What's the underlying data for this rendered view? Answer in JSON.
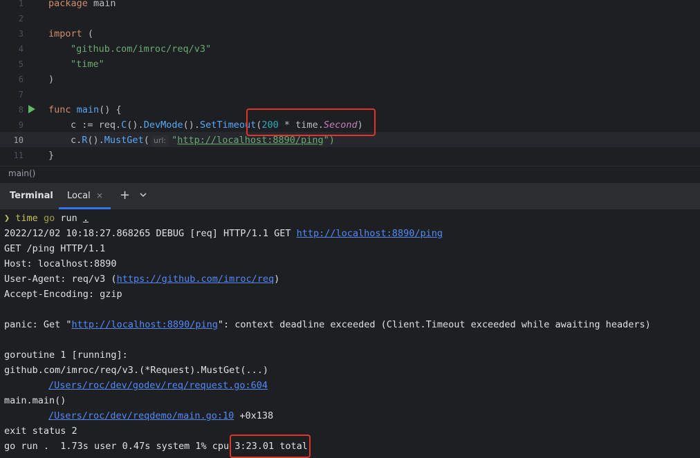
{
  "editor": {
    "line_numbers": [
      "1",
      "2",
      "3",
      "4",
      "5",
      "6",
      "7",
      "8",
      "9",
      "10",
      "11"
    ],
    "lines": {
      "l1_kw": "package",
      "l1_rest": " main",
      "l3_kw": "import",
      "l3_rest": " (",
      "l4": "\"github.com/imroc/req/v3\"",
      "l5": "\"time\"",
      "l6": ")",
      "l8_kw": "func",
      "l8_fn": "main",
      "l8_rest": "() {",
      "l9_a": "c := ",
      "l9_pkg": "req.",
      "l9_c": "C",
      "l9_p1": "().",
      "l9_dev": "DevMode",
      "l9_p2": "().",
      "l9_set": "SetTimeout",
      "l9_p3": "(",
      "l9_num": "200",
      "l9_op": " * time.",
      "l9_type": "Second",
      "l9_end": ")",
      "l10_a": "c.",
      "l10_r": "R",
      "l10_b": "().",
      "l10_must": "MustGet",
      "l10_c": "(",
      "l10_hint": "url:",
      "l10_q1": "\"",
      "l10_url": "http://localhost:8890/ping",
      "l10_q2": "\")",
      "l11": "}"
    }
  },
  "breadcrumb": "main()",
  "terminal": {
    "title": "Terminal",
    "tab_label": "Local",
    "tab_close": "×",
    "add": "+",
    "prompt_symbol": "❯",
    "prompt_time": "time",
    "prompt_go": "go",
    "prompt_rest": "run",
    "prompt_dot": ".",
    "out1_a": "2022/12/02 10:18:27.868265 DEBUG [req] HTTP/1.1 GET ",
    "out1_link": "http://localhost:8890/ping",
    "out2": "GET /ping HTTP/1.1",
    "out3": "Host: localhost:8890",
    "out4_a": "User-Agent: req/v3 (",
    "out4_link": "https://github.com/imroc/req",
    "out4_b": ")",
    "out5": "Accept-Encoding: gzip",
    "out7_a": "panic: Get \"",
    "out7_link": "http://localhost:8890/ping",
    "out7_b": "\": context deadline exceeded (Client.Timeout exceeded while awaiting headers)",
    "out9": "goroutine 1 [running]:",
    "out10": "github.com/imroc/req/v3.(*Request).MustGet(...)",
    "out11_link": "/Users/roc/dev/godev/req/request.go:604",
    "out12": "main.main()",
    "out13_link": "/Users/roc/dev/reqdemo/main.go:10",
    "out13_b": " +0x138",
    "out14": "exit status 2",
    "out15": "go run .  1.73s user 0.47s system 1% cpu 3:23.01 total"
  },
  "colors": {
    "highlight_box": "#e0352b",
    "accent": "#3574f0",
    "link": "#548af7"
  }
}
